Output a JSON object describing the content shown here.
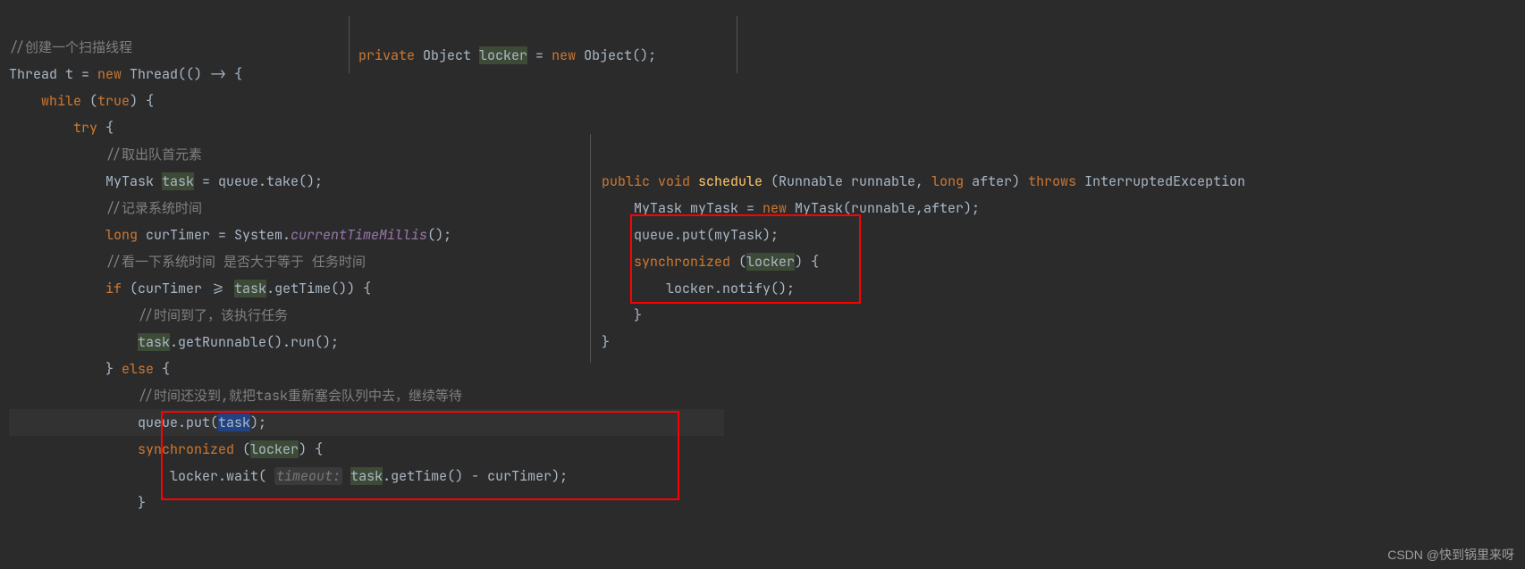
{
  "left": {
    "c1": "//创建一个扫描线程",
    "l2_a": "Thread t = ",
    "l2_b": "new",
    "l2_c": " Thread(() -> {",
    "l3_a": "while",
    "l3_b": " (",
    "l3_c": "true",
    "l3_d": ") {",
    "l4_a": "try",
    "l4_b": " {",
    "c2": "//取出队首元素",
    "l6_a": "MyTask ",
    "l6_task": "task",
    "l6_b": " = queue.take();",
    "c3": "//记录系统时间",
    "l8_a": "long",
    "l8_b": " curTimer = System.",
    "l8_c": "currentTimeMillis",
    "l8_d": "();",
    "c4": "//看一下系统时间 是否大于等于 任务时间",
    "l10_a": "if",
    "l10_b": " (curTimer >= ",
    "l10_task": "task",
    "l10_c": ".getTime()) {",
    "c5": "//时间到了，该执行任务",
    "l12_task": "task",
    "l12_b": ".getRunnable().run();",
    "l13_a": "} ",
    "l13_b": "else",
    "l13_c": " {",
    "c6": "//时间还没到,就把task重新塞会队列中去，继续等待",
    "l15_a": "queue.put(",
    "l15_task": "task",
    "l15_b": ");",
    "l16_a": "synchronized",
    "l16_b": " (",
    "l16_locker": "locker",
    "l16_c": ") {",
    "l17_a": "locker.wait( ",
    "l17_hint": "timeout:",
    "l17_task": "task",
    "l17_b": ".getTime() - curTimer);",
    "l18": "}"
  },
  "top": {
    "a": "private",
    "b": " Object ",
    "locker": "locker",
    "c": " = ",
    "d": "new",
    "e": " Object();"
  },
  "right": {
    "l1_a": "public",
    "l1_b": " void",
    "l1_c": " schedule ",
    "l1_d": "(Runnable runnable, ",
    "l1_e": "long",
    "l1_f": " after) ",
    "l1_g": "throws",
    "l1_h": " InterruptedException ",
    "l2_a": "MyTask myTask = ",
    "l2_b": "new",
    "l2_c": " MyTask(runnable,after);",
    "l3": "queue.put(myTask);",
    "l4_a": "synchronized",
    "l4_b": " (",
    "l4_locker": "locker",
    "l4_c": ") {",
    "l5": "locker.notify();",
    "l6": "}",
    "l7": "}"
  },
  "watermark": "CSDN @快到锅里来呀"
}
